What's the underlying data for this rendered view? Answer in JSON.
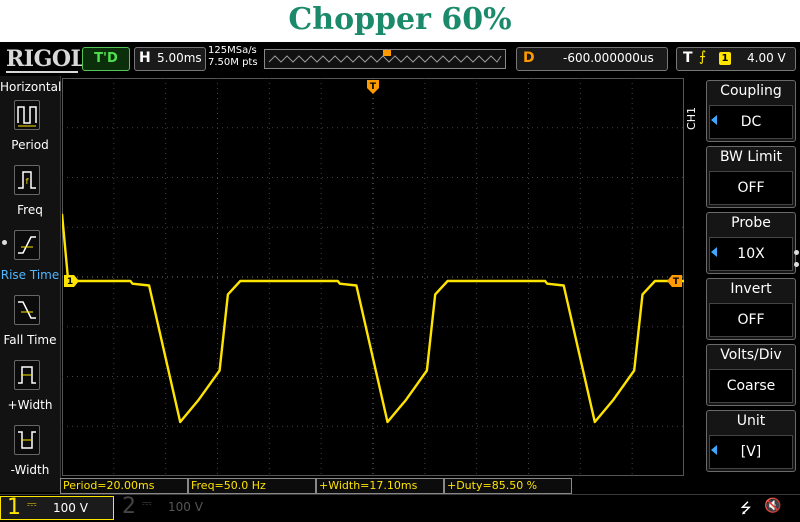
{
  "title": "Chopper 60%",
  "brand": "RIGOL",
  "header": {
    "trig_status": "T'D",
    "h_key": "H",
    "h_timebase": "5.00ms",
    "sample_rate": "125MSa/s",
    "mem_depth": "7.50M pts",
    "d_key": "D",
    "delay": "-600.000000us",
    "t_key": "T",
    "trig_source": "1",
    "trig_level": "4.00 V"
  },
  "left_menu": {
    "title": "Horizontal",
    "items": [
      {
        "label": "Period",
        "icon": "period-icon"
      },
      {
        "label": "Freq",
        "icon": "freq-icon"
      },
      {
        "label": "Rise Time",
        "icon": "rise-time-icon"
      },
      {
        "label": "Fall Time",
        "icon": "fall-time-icon"
      },
      {
        "label": "+Width",
        "icon": "positive-width-icon"
      },
      {
        "label": "-Width",
        "icon": "negative-width-icon"
      }
    ]
  },
  "right_menu": {
    "channel_tab": "CH1",
    "items": [
      {
        "label": "Coupling",
        "value": "DC"
      },
      {
        "label": "BW Limit",
        "value": "OFF"
      },
      {
        "label": "Probe",
        "value": "10X"
      },
      {
        "label": "Invert",
        "value": "OFF"
      },
      {
        "label": "Volts/Div",
        "value": "Coarse"
      },
      {
        "label": "Unit",
        "value": "[V]"
      }
    ]
  },
  "measurements": [
    "Period=20.00ms",
    "Freq=50.0 Hz",
    "+Width=17.10ms",
    "+Duty=85.50 %"
  ],
  "channels": [
    {
      "number": "1",
      "coupling": "DC",
      "scale": "100 V"
    },
    {
      "number": "2",
      "coupling": "DC",
      "scale": "100 V"
    }
  ],
  "markers": {
    "trigger_pos": "T",
    "ch1_ref": "1",
    "trig_level": "T"
  },
  "colors": {
    "ch1": "#ffe400",
    "accent": "#ff9a00",
    "title": "#1b8a6b"
  },
  "chart_data": {
    "type": "line",
    "x": [
      0,
      0.3,
      3.3,
      3.4,
      4.2,
      5.7,
      6.6,
      7.6,
      8.0,
      8.6,
      9.6,
      10.0,
      13.3,
      13.4,
      14.2,
      15.7,
      16.6,
      17.6,
      18.0,
      18.6,
      19.6,
      20.0,
      23.3,
      23.4,
      24.2,
      25.7,
      26.6,
      27.6,
      28.0,
      28.6,
      29.6,
      30.0
    ],
    "y": [
      150,
      0,
      0,
      -6,
      -10,
      -315,
      -265,
      -200,
      -30,
      0,
      0,
      0,
      0,
      -6,
      -10,
      -315,
      -265,
      -200,
      -30,
      0,
      0,
      0,
      0,
      -6,
      -10,
      -315,
      -265,
      -200,
      -30,
      0,
      0,
      0
    ],
    "note_series": "CH1 voltage (V)",
    "xlim": [
      0,
      30
    ],
    "ylim": [
      -400,
      400
    ],
    "grid": true
  }
}
